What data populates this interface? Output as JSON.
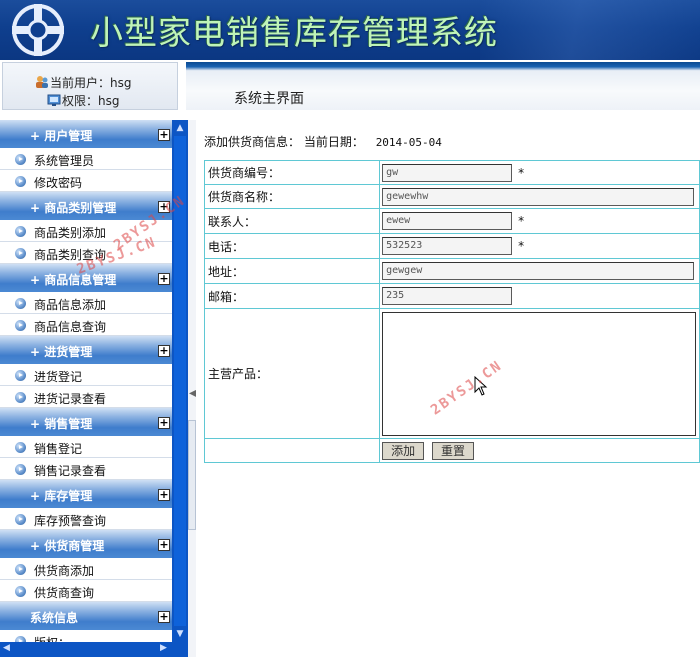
{
  "app": {
    "title": "小型家电销售库存管理系统"
  },
  "user": {
    "current_label": "当前用户：hsg",
    "role_label": "权限：hsg"
  },
  "page": {
    "title": "系统主界面"
  },
  "sidebar": {
    "sections": [
      {
        "header": "用户管理",
        "items": [
          "系统管理员",
          "修改密码"
        ]
      },
      {
        "header": "商品类别管理",
        "items": [
          "商品类别添加",
          "商品类别查询"
        ]
      },
      {
        "header": "商品信息管理",
        "items": [
          "商品信息添加",
          "商品信息查询"
        ]
      },
      {
        "header": "进货管理",
        "items": [
          "进货登记",
          "进货记录查看"
        ]
      },
      {
        "header": "销售管理",
        "items": [
          "销售登记",
          "销售记录查看"
        ]
      },
      {
        "header": "库存管理",
        "items": [
          "库存预警查询"
        ]
      },
      {
        "header": "供货商管理",
        "items": [
          "供货商添加",
          "供货商查询"
        ]
      },
      {
        "header": "系统信息",
        "items": [
          "版权：........"
        ]
      }
    ]
  },
  "form": {
    "heading": "添加供货商信息：",
    "date_label": "当前日期：",
    "date_value": "2014-05-04",
    "fields": {
      "code": {
        "label": "供货商编号：",
        "value": "gw"
      },
      "name": {
        "label": "供货商名称：",
        "value": "gewewhw"
      },
      "contact": {
        "label": "联系人：",
        "value": "ewew"
      },
      "phone": {
        "label": "电话：",
        "value": "532523"
      },
      "address": {
        "label": "地址：",
        "value": "gewgew"
      },
      "email": {
        "label": "邮箱：",
        "value": "235"
      },
      "products": {
        "label": "主营产品：",
        "value": ""
      }
    },
    "required_mark": "*",
    "submit_label": "添加",
    "reset_label": "重置"
  },
  "watermarks": [
    "2BYSJ.CN",
    "2BYSJ.CN",
    "2BYSJ.CN"
  ],
  "colors": {
    "banner": "#0f3f8e",
    "title_text": "#bff4b8",
    "menu_header": "#3f7dcc",
    "table_border": "#5fc8d4",
    "scrollbar": "#0c55c4"
  }
}
